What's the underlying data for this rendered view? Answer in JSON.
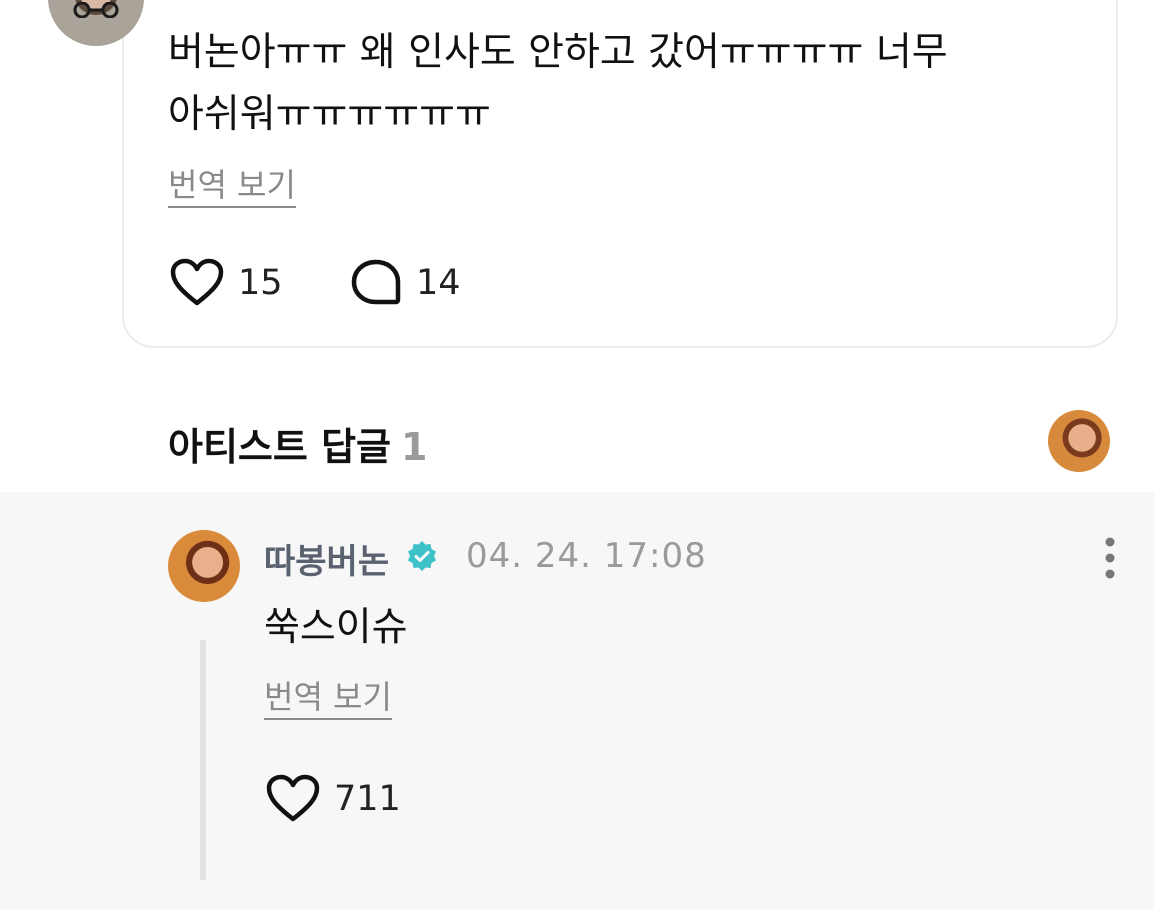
{
  "comment": {
    "text_line1": "버논아ㅠㅠ 왜 인사도 안하고 갔어ㅠㅠㅠㅠ 너무",
    "text_line2": "아쉬워ㅠㅠㅠㅠㅠㅠ",
    "translate_label": "번역 보기",
    "likes": "15",
    "replies": "14"
  },
  "artist_section": {
    "title": "아티스트 답글",
    "count": "1"
  },
  "artist_reply": {
    "author": "따봉버논",
    "timestamp": "04. 24. 17:08",
    "text": "쑥스이슈",
    "translate_label": "번역 보기",
    "likes": "711"
  },
  "colors": {
    "verified": "#3fc1c9",
    "muted_text": "#8a8a8a",
    "reply_background": "#f7f7f8"
  },
  "icons": [
    "heart-icon",
    "comment-bubble-icon",
    "verified-badge-icon",
    "more-vertical-icon"
  ]
}
